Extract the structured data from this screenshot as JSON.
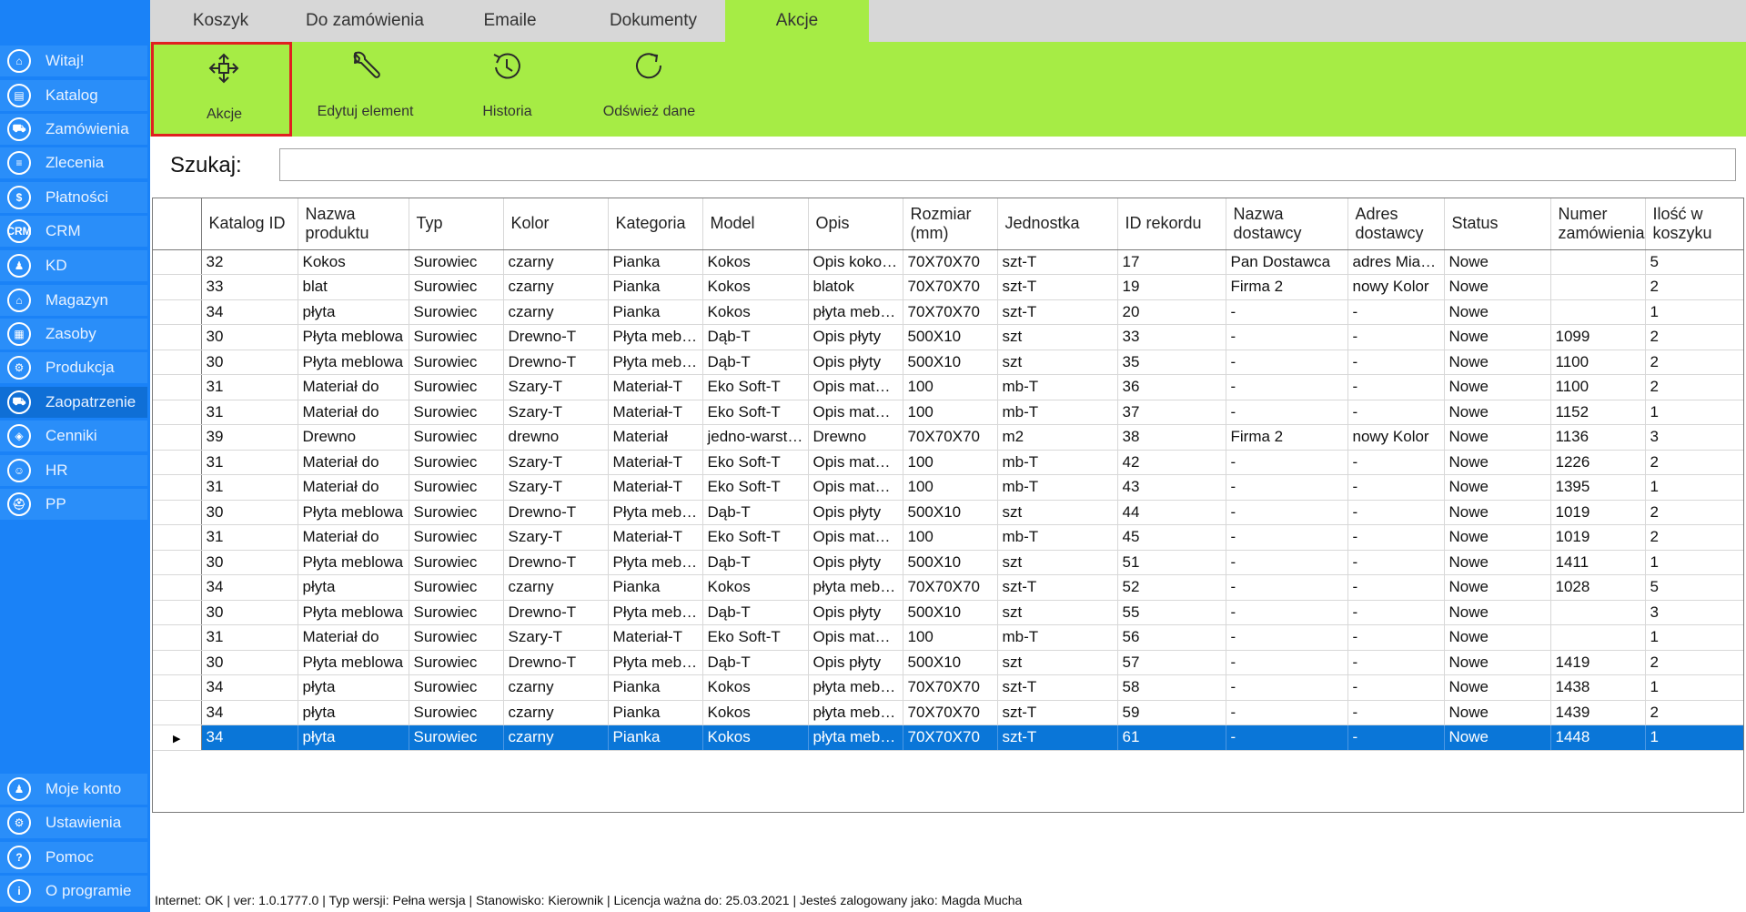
{
  "sidebar": {
    "items": [
      {
        "label": "Witaj!",
        "icon": "home-icon",
        "glyph": "⌂"
      },
      {
        "label": "Katalog",
        "icon": "book-icon",
        "glyph": "▤"
      },
      {
        "label": "Zamówienia",
        "icon": "cart-icon",
        "glyph": "⛟"
      },
      {
        "label": "Zlecenia",
        "icon": "list-icon",
        "glyph": "≡"
      },
      {
        "label": "Płatności",
        "icon": "dollar-icon",
        "glyph": "$"
      },
      {
        "label": "CRM",
        "icon": "crm-icon",
        "glyph": "CRM"
      },
      {
        "label": "KD",
        "icon": "user-icon",
        "glyph": "♟"
      },
      {
        "label": "Magazyn",
        "icon": "warehouse-icon",
        "glyph": "⌂"
      },
      {
        "label": "Zasoby",
        "icon": "resources-icon",
        "glyph": "▦"
      },
      {
        "label": "Produkcja",
        "icon": "production-icon",
        "glyph": "⚙"
      },
      {
        "label": "Zaopatrzenie",
        "icon": "truck-icon",
        "glyph": "⛟"
      },
      {
        "label": "Cenniki",
        "icon": "tag-icon",
        "glyph": "◈"
      },
      {
        "label": "HR",
        "icon": "hr-icon",
        "glyph": "☺"
      },
      {
        "label": "PP",
        "icon": "pp-icon",
        "glyph": "⛑"
      }
    ],
    "bottom_items": [
      {
        "label": "Moje konto",
        "icon": "account-icon",
        "glyph": "♟"
      },
      {
        "label": "Ustawienia",
        "icon": "settings-icon",
        "glyph": "⚙"
      },
      {
        "label": "Pomoc",
        "icon": "help-icon",
        "glyph": "?"
      },
      {
        "label": "O programie",
        "icon": "info-icon",
        "glyph": "i"
      }
    ]
  },
  "tabs": [
    {
      "label": "Koszyk"
    },
    {
      "label": "Do zamówienia"
    },
    {
      "label": "Emaile"
    },
    {
      "label": "Dokumenty"
    },
    {
      "label": "Akcje",
      "active": true
    }
  ],
  "ribbon": {
    "buttons": [
      {
        "label": "Akcje",
        "icon": "move-arrows-icon"
      },
      {
        "label": "Edytuj element",
        "icon": "wrench-icon"
      },
      {
        "label": "Historia",
        "icon": "history-icon"
      },
      {
        "label": "Odśwież dane",
        "icon": "refresh-icon"
      }
    ]
  },
  "search": {
    "label": "Szukaj:",
    "value": "",
    "placeholder": ""
  },
  "grid": {
    "columns": [
      {
        "label": "Katalog ID"
      },
      {
        "label": "Nazwa produktu"
      },
      {
        "label": "Typ"
      },
      {
        "label": "Kolor"
      },
      {
        "label": "Kategoria"
      },
      {
        "label": "Model"
      },
      {
        "label": "Opis"
      },
      {
        "label": "Rozmiar (mm)"
      },
      {
        "label": "Jednostka"
      },
      {
        "label": "ID rekordu"
      },
      {
        "label": "Nazwa dostawcy"
      },
      {
        "label": "Adres dostawcy"
      },
      {
        "label": "Status"
      },
      {
        "label": "Numer zamówienia"
      },
      {
        "label": "Ilość w koszyku"
      }
    ],
    "rows": [
      [
        "32",
        "Kokos",
        "Surowiec",
        "czarny",
        "Pianka",
        "Kokos",
        "Opis kokosu",
        "70X70X70",
        "szt-T",
        "17",
        "Pan Dostawca",
        "adres Miasto",
        "Nowe",
        "",
        "5"
      ],
      [
        "33",
        "blat",
        "Surowiec",
        "czarny",
        "Pianka",
        "Kokos",
        "blatok",
        "70X70X70",
        "szt-T",
        "19",
        "Firma 2",
        "nowy Kolor",
        "Nowe",
        "",
        "2"
      ],
      [
        "34",
        "płyta",
        "Surowiec",
        "czarny",
        "Pianka",
        "Kokos",
        "płyta meblowa",
        "70X70X70",
        "szt-T",
        "20",
        "-",
        "-",
        "Nowe",
        "",
        "1"
      ],
      [
        "30",
        "Płyta meblowa",
        "Surowiec",
        "Drewno-T",
        "Płyta meblowa",
        "Dąb-T",
        "Opis płyty",
        "500X10",
        "szt",
        "33",
        "-",
        "-",
        "Nowe",
        "1099",
        "2"
      ],
      [
        "30",
        "Płyta meblowa",
        "Surowiec",
        "Drewno-T",
        "Płyta meblowa",
        "Dąb-T",
        "Opis płyty",
        "500X10",
        "szt",
        "35",
        "-",
        "-",
        "Nowe",
        "1100",
        "2"
      ],
      [
        "31",
        "Materiał do",
        "Surowiec",
        "Szary-T",
        "Materiał-T",
        "Eko Soft-T",
        "Opis materiału",
        "100",
        "mb-T",
        "36",
        "-",
        "-",
        "Nowe",
        "1100",
        "2"
      ],
      [
        "31",
        "Materiał do",
        "Surowiec",
        "Szary-T",
        "Materiał-T",
        "Eko Soft-T",
        "Opis materiału",
        "100",
        "mb-T",
        "37",
        "-",
        "-",
        "Nowe",
        "1152",
        "1"
      ],
      [
        "39",
        "Drewno",
        "Surowiec",
        "drewno",
        "Materiał",
        "jedno-warstwowe",
        "Drewno",
        "70X70X70",
        "m2",
        "38",
        "Firma 2",
        "nowy Kolor",
        "Nowe",
        "1136",
        "3"
      ],
      [
        "31",
        "Materiał do",
        "Surowiec",
        "Szary-T",
        "Materiał-T",
        "Eko Soft-T",
        "Opis materiału",
        "100",
        "mb-T",
        "42",
        "-",
        "-",
        "Nowe",
        "1226",
        "2"
      ],
      [
        "31",
        "Materiał do",
        "Surowiec",
        "Szary-T",
        "Materiał-T",
        "Eko Soft-T",
        "Opis materiału",
        "100",
        "mb-T",
        "43",
        "-",
        "-",
        "Nowe",
        "1395",
        "1"
      ],
      [
        "30",
        "Płyta meblowa",
        "Surowiec",
        "Drewno-T",
        "Płyta meblowa",
        "Dąb-T",
        "Opis płyty",
        "500X10",
        "szt",
        "44",
        "-",
        "-",
        "Nowe",
        "1019",
        "2"
      ],
      [
        "31",
        "Materiał do",
        "Surowiec",
        "Szary-T",
        "Materiał-T",
        "Eko Soft-T",
        "Opis materiału",
        "100",
        "mb-T",
        "45",
        "-",
        "-",
        "Nowe",
        "1019",
        "2"
      ],
      [
        "30",
        "Płyta meblowa",
        "Surowiec",
        "Drewno-T",
        "Płyta meblowa",
        "Dąb-T",
        "Opis płyty",
        "500X10",
        "szt",
        "51",
        "-",
        "-",
        "Nowe",
        "1411",
        "1"
      ],
      [
        "34",
        "płyta",
        "Surowiec",
        "czarny",
        "Pianka",
        "Kokos",
        "płyta meblowa",
        "70X70X70",
        "szt-T",
        "52",
        "-",
        "-",
        "Nowe",
        "1028",
        "5"
      ],
      [
        "30",
        "Płyta meblowa",
        "Surowiec",
        "Drewno-T",
        "Płyta meblowa",
        "Dąb-T",
        "Opis płyty",
        "500X10",
        "szt",
        "55",
        "-",
        "-",
        "Nowe",
        "",
        "3"
      ],
      [
        "31",
        "Materiał do",
        "Surowiec",
        "Szary-T",
        "Materiał-T",
        "Eko Soft-T",
        "Opis materiału",
        "100",
        "mb-T",
        "56",
        "-",
        "-",
        "Nowe",
        "",
        "1"
      ],
      [
        "30",
        "Płyta meblowa",
        "Surowiec",
        "Drewno-T",
        "Płyta meblowa",
        "Dąb-T",
        "Opis płyty",
        "500X10",
        "szt",
        "57",
        "-",
        "-",
        "Nowe",
        "1419",
        "2"
      ],
      [
        "34",
        "płyta",
        "Surowiec",
        "czarny",
        "Pianka",
        "Kokos",
        "płyta meblowa",
        "70X70X70",
        "szt-T",
        "58",
        "-",
        "-",
        "Nowe",
        "1438",
        "1"
      ],
      [
        "34",
        "płyta",
        "Surowiec",
        "czarny",
        "Pianka",
        "Kokos",
        "płyta meblowa",
        "70X70X70",
        "szt-T",
        "59",
        "-",
        "-",
        "Nowe",
        "1439",
        "2"
      ],
      [
        "34",
        "płyta",
        "Surowiec",
        "czarny",
        "Pianka",
        "Kokos",
        "płyta meblowa",
        "70X70X70",
        "szt-T",
        "61",
        "-",
        "-",
        "Nowe",
        "1448",
        "1"
      ]
    ],
    "selected_row": 19,
    "row_pointer": "▶"
  },
  "statusbar": {
    "text": "Internet: OK  |   ver: 1.0.1777.0   |   Typ wersji: Pełna wersja   |   Stanowisko: Kierownik   |   Licencja ważna do: 25.03.2021   |   Jesteś zalogowany jako: Magda Mucha"
  },
  "colors": {
    "sidebar": "#1a82f7",
    "ribbon": "#a6ec45",
    "selection": "#0a76d8",
    "highlight": "#e02020"
  }
}
